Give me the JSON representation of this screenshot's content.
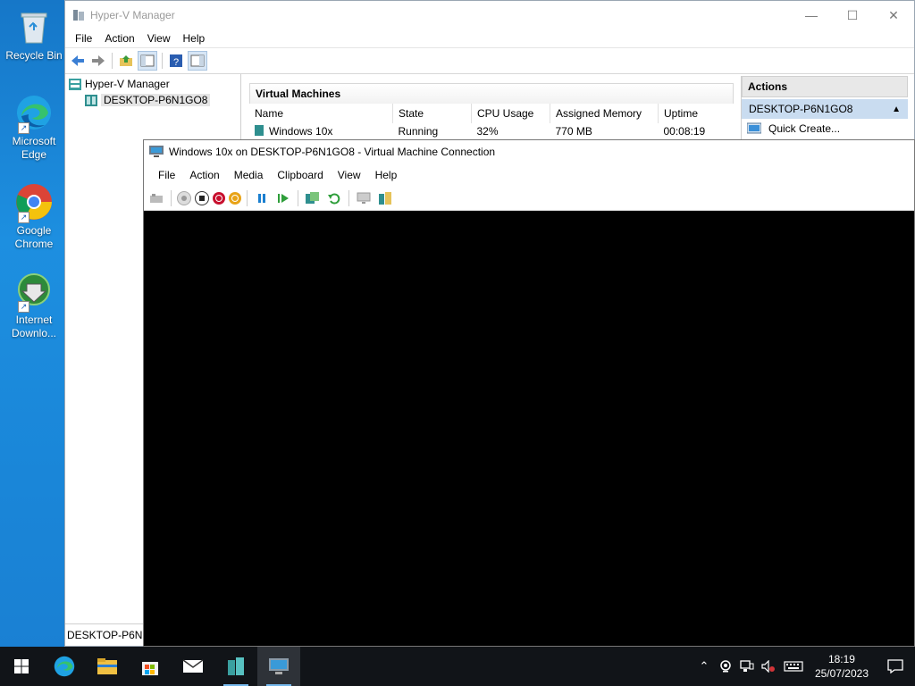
{
  "desktop": {
    "icons": [
      {
        "name": "recycle-bin",
        "label": "Recycle Bin"
      },
      {
        "name": "microsoft-edge",
        "label": "Microsoft Edge"
      },
      {
        "name": "google-chrome",
        "label": "Google Chrome"
      },
      {
        "name": "internet-download-manager",
        "label": "Internet Downlo..."
      }
    ]
  },
  "hyperv": {
    "title": "Hyper-V Manager",
    "menu": [
      "File",
      "Action",
      "View",
      "Help"
    ],
    "tree": {
      "root": "Hyper-V Manager",
      "host": "DESKTOP-P6N1GO8"
    },
    "vm_pane": {
      "header": "Virtual Machines",
      "columns": [
        "Name",
        "State",
        "CPU Usage",
        "Assigned Memory",
        "Uptime"
      ],
      "rows": [
        {
          "name": "Windows 10x",
          "state": "Running",
          "cpu": "32%",
          "memory": "770 MB",
          "uptime": "00:08:19"
        }
      ]
    },
    "actions": {
      "header": "Actions",
      "host": "DESKTOP-P6N1GO8",
      "items": [
        "Quick Create..."
      ]
    },
    "status": "DESKTOP-P6N1GO8"
  },
  "vmconnect": {
    "title": "Windows 10x on DESKTOP-P6N1GO8 - Virtual Machine Connection",
    "menu": [
      "File",
      "Action",
      "Media",
      "Clipboard",
      "View",
      "Help"
    ]
  },
  "taskbar": {
    "clock_time": "18:19",
    "clock_date": "25/07/2023"
  },
  "colors": {
    "desktop_bg": "#1a86d8",
    "taskbar_bg": "#111418",
    "selection": "#c9dcf0",
    "accent": "#76b9ed"
  }
}
